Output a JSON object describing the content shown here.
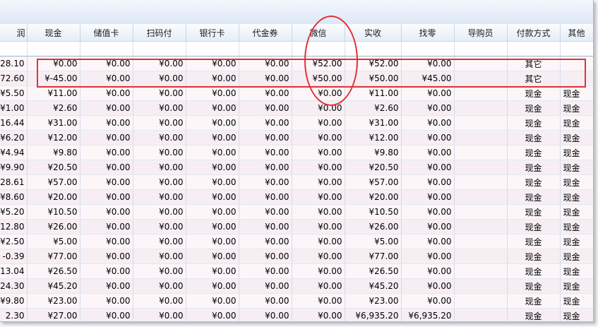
{
  "columns": [
    "润",
    "现金",
    "储值卡",
    "扫码付",
    "银行卡",
    "代金券",
    "微信",
    "实收",
    "找零",
    "导购员",
    "付款方式",
    "其他"
  ],
  "rows": [
    [
      "28.10",
      "¥0.00",
      "¥0.00",
      "¥0.00",
      "¥0.00",
      "¥0.00",
      "¥52.00",
      "¥52.00",
      "¥0.00",
      "",
      "其它",
      ""
    ],
    [
      "72.60",
      "¥-45.00",
      "¥0.00",
      "¥0.00",
      "¥0.00",
      "¥0.00",
      "¥50.00",
      "¥50.00",
      "¥45.00",
      "",
      "其它",
      ""
    ],
    [
      "¥5.50",
      "¥11.00",
      "¥0.00",
      "¥0.00",
      "¥0.00",
      "¥0.00",
      "¥0.00",
      "¥11.00",
      "¥0.00",
      "",
      "现金",
      "现金"
    ],
    [
      "¥1.00",
      "¥2.60",
      "¥0.00",
      "¥0.00",
      "¥0.00",
      "¥0.00",
      "¥0.00",
      "¥2.60",
      "¥0.00",
      "",
      "现金",
      "现金"
    ],
    [
      "16.44",
      "¥31.00",
      "¥0.00",
      "¥0.00",
      "¥0.00",
      "¥0.00",
      "¥0.00",
      "¥31.00",
      "¥0.00",
      "",
      "现金",
      "现金"
    ],
    [
      "¥6.20",
      "¥12.00",
      "¥0.00",
      "¥0.00",
      "¥0.00",
      "¥0.00",
      "¥0.00",
      "¥12.00",
      "¥0.00",
      "",
      "现金",
      "现金"
    ],
    [
      "¥4.94",
      "¥9.80",
      "¥0.00",
      "¥0.00",
      "¥0.00",
      "¥0.00",
      "¥0.00",
      "¥9.80",
      "¥0.00",
      "",
      "现金",
      "现金"
    ],
    [
      "¥9.90",
      "¥20.50",
      "¥0.00",
      "¥0.00",
      "¥0.00",
      "¥0.00",
      "¥0.00",
      "¥20.50",
      "¥0.00",
      "",
      "现金",
      "现金"
    ],
    [
      "28.61",
      "¥57.00",
      "¥0.00",
      "¥0.00",
      "¥0.00",
      "¥0.00",
      "¥0.00",
      "¥57.00",
      "¥0.00",
      "",
      "现金",
      "现金"
    ],
    [
      "¥8.60",
      "¥20.00",
      "¥0.00",
      "¥0.00",
      "¥0.00",
      "¥0.00",
      "¥0.00",
      "¥20.00",
      "¥0.00",
      "",
      "现金",
      "现金"
    ],
    [
      "¥5.20",
      "¥10.50",
      "¥0.00",
      "¥0.00",
      "¥0.00",
      "¥0.00",
      "¥0.00",
      "¥10.50",
      "¥0.00",
      "",
      "现金",
      "现金"
    ],
    [
      "12.80",
      "¥26.00",
      "¥0.00",
      "¥0.00",
      "¥0.00",
      "¥0.00",
      "¥0.00",
      "¥26.00",
      "¥0.00",
      "",
      "现金",
      "现金"
    ],
    [
      "¥2.50",
      "¥5.00",
      "¥0.00",
      "¥0.00",
      "¥0.00",
      "¥0.00",
      "¥0.00",
      "¥5.00",
      "¥0.00",
      "",
      "现金",
      "现金"
    ],
    [
      "-0.39",
      "¥77.00",
      "¥0.00",
      "¥0.00",
      "¥0.00",
      "¥0.00",
      "¥0.00",
      "¥77.00",
      "¥0.00",
      "",
      "现金",
      "现金"
    ],
    [
      "13.04",
      "¥26.50",
      "¥0.00",
      "¥0.00",
      "¥0.00",
      "¥0.00",
      "¥0.00",
      "¥26.50",
      "¥0.00",
      "",
      "现金",
      "现金"
    ],
    [
      "24.30",
      "¥45.20",
      "¥0.00",
      "¥0.00",
      "¥0.00",
      "¥0.00",
      "¥0.00",
      "¥45.20",
      "¥0.00",
      "",
      "现金",
      "现金"
    ],
    [
      "¥9.80",
      "¥23.00",
      "¥0.00",
      "¥0.00",
      "¥0.00",
      "¥0.00",
      "¥0.00",
      "¥23.00",
      "¥0.00",
      "",
      "现金",
      "现金"
    ],
    [
      "2.30",
      "¥27.00",
      "¥0.00",
      "¥0.00",
      "¥0.00",
      "¥0.00",
      "¥0.00",
      "¥6,935.20",
      "¥6,935.20",
      "",
      "现金",
      "现金"
    ]
  ],
  "colors": {
    "annotation": "#e0323a",
    "header_bg": "#e6edf7",
    "row_bg": "#fdf6f8",
    "row_alt_bg": "#f7eef3"
  }
}
